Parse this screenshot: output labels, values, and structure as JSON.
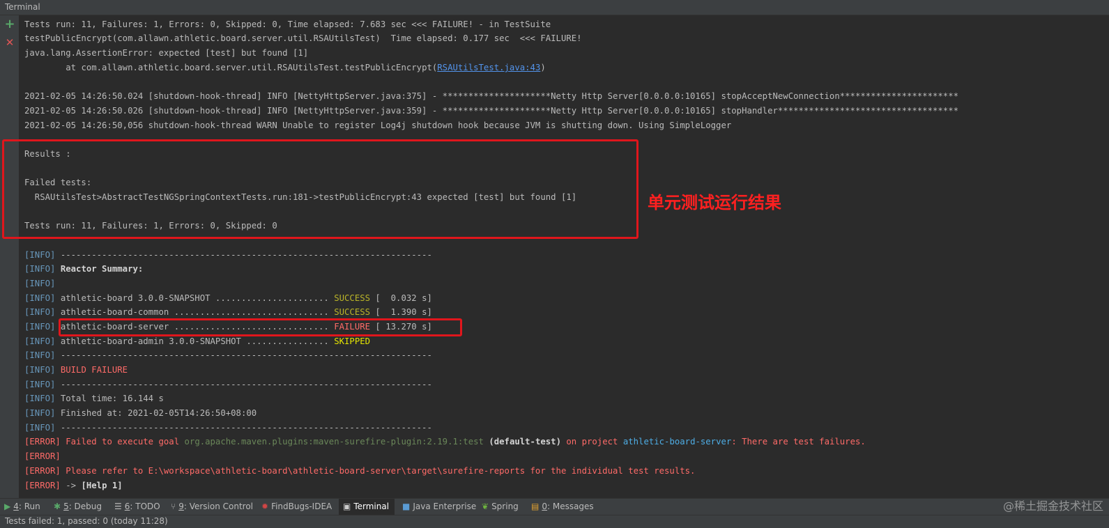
{
  "window": {
    "title": "Terminal"
  },
  "gutter": {
    "add_glyph": "+",
    "close_glyph": "✕",
    "add_icon": "plus-icon",
    "close_icon": "close-icon"
  },
  "console": {
    "l1": "Tests run: 11, Failures: 1, Errors: 0, Skipped: 0, Time elapsed: 7.683 sec <<< FAILURE! - in TestSuite",
    "l2": "testPublicEncrypt(com.allawn.athletic.board.server.util.RSAUtilsTest)  Time elapsed: 0.177 sec  <<< FAILURE!",
    "l3": "java.lang.AssertionError: expected [test] but found [1]",
    "l4_pre": "\tat com.allawn.athletic.board.server.util.RSAUtilsTest.testPublicEncrypt(",
    "l4_link": "RSAUtilsTest.java:43",
    "l4_post": ")",
    "l6": "2021-02-05 14:26:50.024 [shutdown-hook-thread] INFO [NettyHttpServer.java:375] - *********************Netty Http Server[0.0.0.0:10165] stopAcceptNewConnection***********************",
    "l7": "2021-02-05 14:26:50.026 [shutdown-hook-thread] INFO [NettyHttpServer.java:359] - *********************Netty Http Server[0.0.0.0:10165] stopHandler***********************************",
    "l8": "2021-02-05 14:26:50,056 shutdown-hook-thread WARN Unable to register Log4j shutdown hook because JVM is shutting down. Using SimpleLogger",
    "l10": "Results :",
    "l12": "Failed tests:",
    "l13": "  RSAUtilsTest>AbstractTestNGSpringContextTests.run:181->testPublicEncrypt:43 expected [test] but found [1]",
    "l15": "Tests run: 11, Failures: 1, Errors: 0, Skipped: 0",
    "info_tag": "[INFO]",
    "error_tag": "[ERROR]",
    "dash_line": " ------------------------------------------------------------------------",
    "reactor_summary": " Reactor Summary:",
    "mod1_name": " athletic-board 3.0.0-SNAPSHOT ...................... ",
    "mod1_status": "SUCCESS",
    "mod1_time": " [  0.032 s]",
    "mod2_name": " athletic-board-common .............................. ",
    "mod2_status": "SUCCESS",
    "mod2_time": " [  1.390 s]",
    "mod3_name": " athletic-board-server .............................. ",
    "mod3_status": "FAILURE",
    "mod3_time": " [ 13.270 s]",
    "mod4_name": " athletic-board-admin 3.0.0-SNAPSHOT ................ ",
    "mod4_status": "SKIPPED",
    "build_failure": " BUILD FAILURE",
    "total_time": " Total time: 16.144 s",
    "finished_at": " Finished at: 2021-02-05T14:26:50+08:00",
    "err1_a": " Failed to execute goal ",
    "err1_plugin": "org.apache.maven.plugins:maven-surefire-plugin:2.19.1:test",
    "err1_b": " (default-test)",
    "err1_c": " on project ",
    "err1_project": "athletic-board-server",
    "err1_d": ": There are test failures.",
    "err3": " Please refer to E:\\workspace\\athletic-board\\athletic-board-server\\target\\surefire-reports for the individual test results.",
    "err4_a": " -> ",
    "err4_b": "[Help 1]"
  },
  "annotation": {
    "text": "单元测试运行结果",
    "color": "#ff2020"
  },
  "toolwindows": {
    "run_num": "4",
    "run_label": ": Run",
    "debug_num": "5",
    "debug_label": ": Debug",
    "todo_num": "6",
    "todo_label": ": TODO",
    "vc_num": "9",
    "vc_label": ": Version Control",
    "findbugs": "FindBugs-IDEA",
    "terminal": "Terminal",
    "java_ee": "Java Enterprise",
    "spring": "Spring",
    "messages_num": "0",
    "messages_label": ": Messages"
  },
  "status": {
    "text": "Tests failed: 1, passed: 0 (today 11:28)"
  },
  "watermark": {
    "text": "@稀土掘金技术社区"
  },
  "colors": {
    "background": "#2b2b2b",
    "info_tag": "#6897bb",
    "success": "#bbb529",
    "failure": "#ff6b68",
    "skipped": "#e5e500",
    "highlight_box": "#e0161c"
  }
}
